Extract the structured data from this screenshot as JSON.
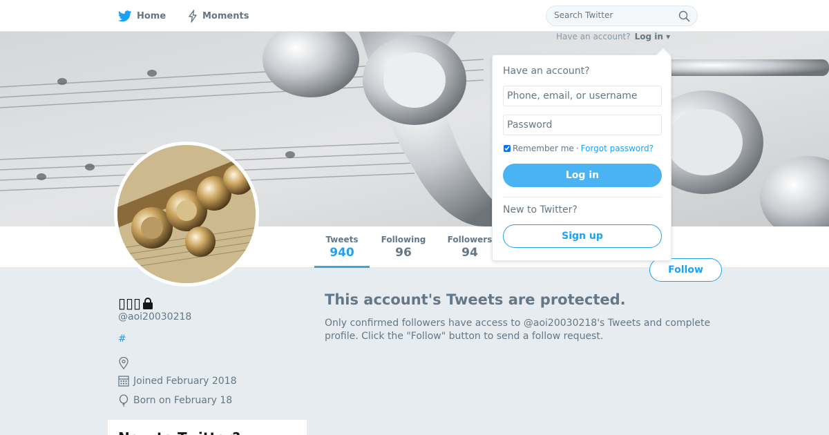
{
  "nav": {
    "home_label": "Home",
    "home_icon": "twitter-bird-icon",
    "moments_label": "Moments",
    "moments_icon": "lightning-icon",
    "search_placeholder": "Search Twitter",
    "search_icon": "search-icon"
  },
  "login_prompt": {
    "text": "Have an account?",
    "link": "Log in"
  },
  "login_dropdown": {
    "heading": "Have an account?",
    "username_placeholder": "Phone, email, or username",
    "password_placeholder": "Password",
    "remember_label": "Remember me",
    "separator": "·",
    "forgot_label": "Forgot password?",
    "login_button": "Log in",
    "new_heading": "New to Twitter?",
    "signup_button": "Sign up"
  },
  "stats": [
    {
      "label": "Tweets",
      "value": "940",
      "active": true
    },
    {
      "label": "Following",
      "value": "96",
      "active": false
    },
    {
      "label": "Followers",
      "value": "94",
      "active": false
    }
  ],
  "follow_button": "Follow",
  "profile": {
    "name": "▯▯▯",
    "protected_icon": "lock-icon",
    "handle": "@aoi20030218",
    "hashtag": "#",
    "location_icon": "location-pin-icon",
    "joined": "Joined February 2018",
    "joined_icon": "calendar-icon",
    "birthday": "Born on February 18",
    "birthday_icon": "balloon-icon"
  },
  "protected": {
    "title": "This account's Tweets are protected.",
    "body": "Only confirmed followers have access to @aoi20030218's Tweets and complete profile. Click the \"Follow\" button to send a follow request."
  },
  "sidebar_card": {
    "title": "New to Twitter?"
  },
  "colors": {
    "accent": "#1da1f2",
    "page_background": "#e6ecf0",
    "muted_text": "#657786",
    "login_button": "#4ab3f4"
  }
}
